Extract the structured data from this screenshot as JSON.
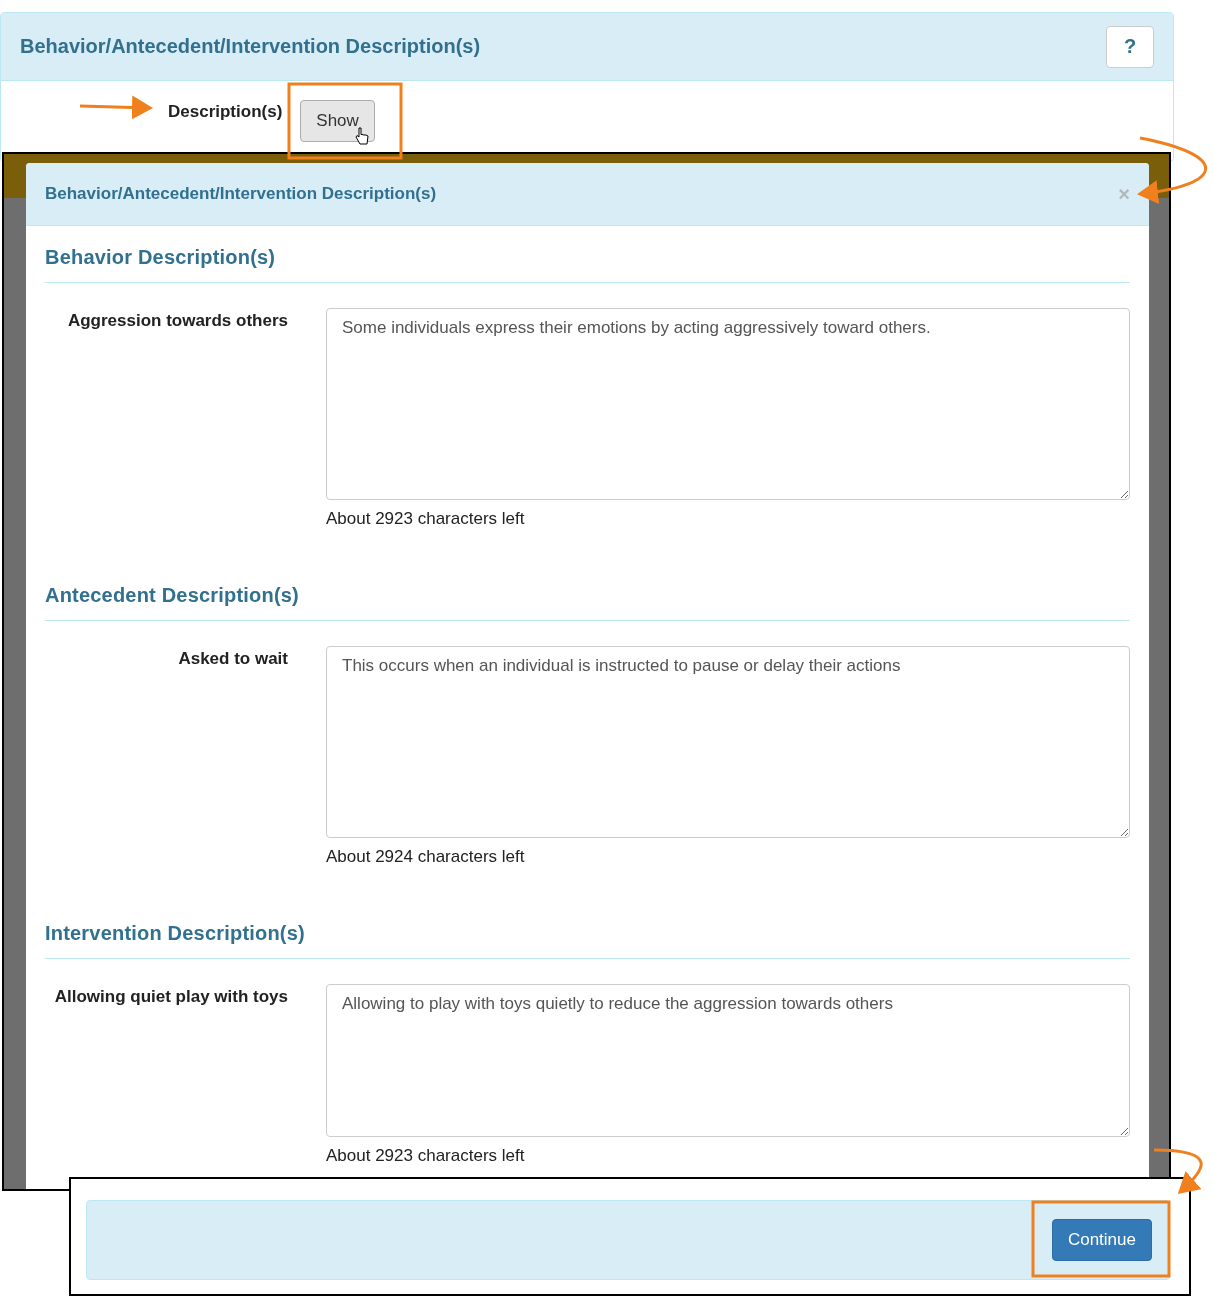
{
  "panel": {
    "title": "Behavior/Antecedent/Intervention Description(s)",
    "help_button": "?",
    "field_label": "Description(s)",
    "show_button": "Show"
  },
  "modal": {
    "title": "Behavior/Antecedent/Intervention Description(s)",
    "close_button": "×",
    "sections": [
      {
        "heading": "Behavior Description(s)",
        "label": "Aggression towards others",
        "value": "Some individuals express their emotions by acting aggressively toward others.",
        "counter": "About 2923 characters left"
      },
      {
        "heading": "Antecedent Description(s)",
        "label": "Asked to wait",
        "value": "This occurs when an individual is instructed to pause or delay their actions",
        "counter": "About 2924 characters left"
      },
      {
        "heading": "Intervention Description(s)",
        "label": "Allowing quiet play with toys",
        "value": "Allowing to play with toys quietly to reduce the aggression towards others",
        "counter": "About 2923 characters left"
      }
    ]
  },
  "footer": {
    "continue_button": "Continue"
  }
}
